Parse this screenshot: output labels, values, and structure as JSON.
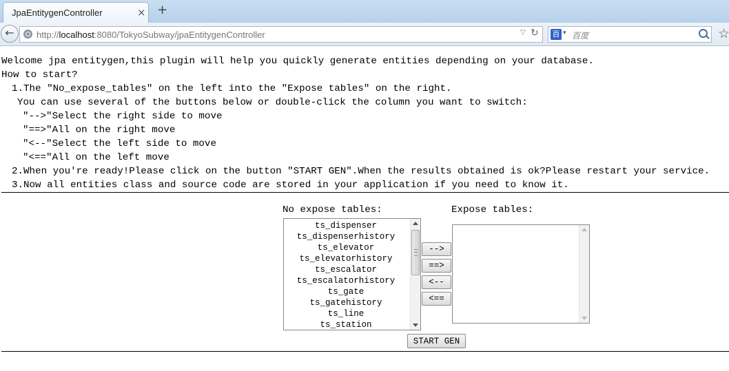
{
  "browser": {
    "tab_title": "JpaEntitygenController",
    "tab_close": "×",
    "new_tab": "+",
    "back_glyph": "←",
    "url_prefix": "http://",
    "url_host": "localhost",
    "url_rest": ":8080/TokyoSubway/jpaEntitygenController",
    "url_drop_glyph": "▽",
    "reload_glyph": "↻",
    "search_engine_glyph": "百",
    "search_drop_glyph": "▾",
    "search_placeholder": "百度",
    "bookmark_glyph": "☆"
  },
  "intro": {
    "welcome": "Welcome jpa entitygen,this plugin will help you quickly generate entities depending on your database.",
    "how_to_start": "How to start?",
    "step1": "1.The \"No_expose_tables\" on the left into the \"Expose tables\" on the right.",
    "step1_note": "You can use several of the buttons below or double-click the column you want to switch:",
    "hint_move_right": "\"-->\"Select the right side to move",
    "hint_all_right": "\"==>\"All on the right move",
    "hint_move_left": "\"<--\"Select the left side to move",
    "hint_all_left": "\"<==\"All on the left move",
    "step2": "2.When you're ready!Please click on the button \"START GEN\".When the results obtained is ok?Please restart your service.",
    "step3": "3.Now all entities class and source code are stored in your application if you need to know it."
  },
  "no_expose": {
    "label": "No expose tables:",
    "items": [
      "ts_dispenser",
      "ts_dispenserhistory",
      "ts_elevator",
      "ts_elevatorhistory",
      "ts_escalator",
      "ts_escalatorhistory",
      "ts_gate",
      "ts_gatehistory",
      "ts_line",
      "ts_station"
    ]
  },
  "expose": {
    "label": "Expose tables:",
    "items": []
  },
  "buttons": {
    "move_right": "-->",
    "all_right": "==>",
    "move_left": "<--",
    "all_left": "<==",
    "start_gen": "START GEN"
  }
}
